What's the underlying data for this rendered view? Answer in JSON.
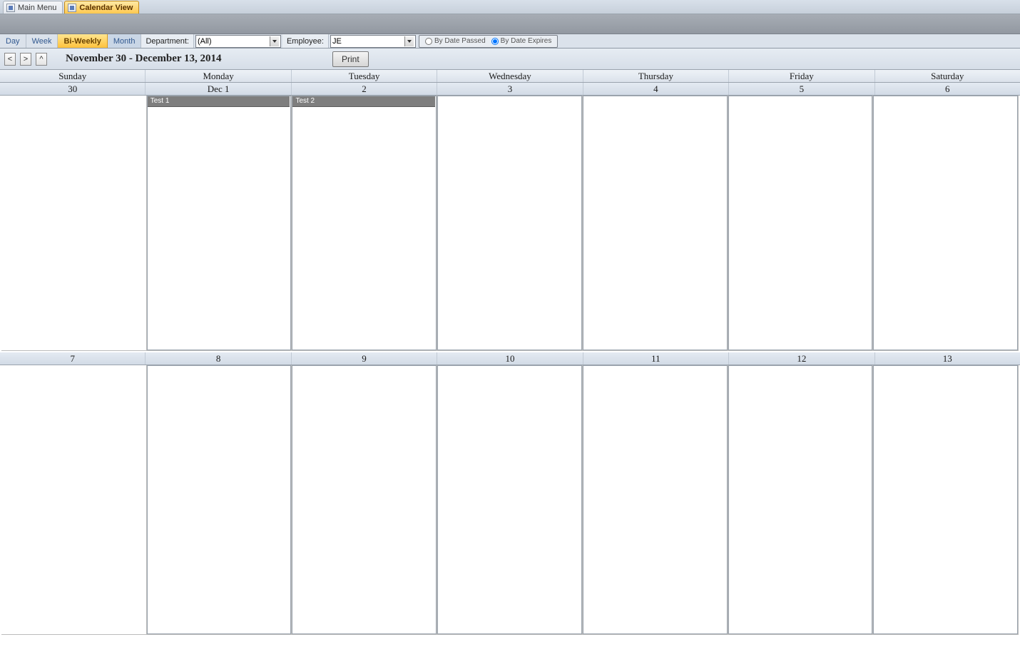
{
  "tabs": {
    "main_menu": "Main Menu",
    "calendar_view": "Calendar View"
  },
  "views": {
    "day": "Day",
    "week": "Week",
    "biweekly": "Bi-Weekly",
    "month": "Month"
  },
  "filters": {
    "department_label": "Department:",
    "department_value": "(All)",
    "employee_label": "Employee:",
    "employee_value": "JE"
  },
  "radios": {
    "by_date_passed": "By Date Passed",
    "by_date_expires": "By Date Expires"
  },
  "nav": {
    "prev": "<",
    "next": ">",
    "up": "^"
  },
  "title": "November 30 - December 13, 2014",
  "print": "Print",
  "day_headers": [
    "Sunday",
    "Monday",
    "Tuesday",
    "Wednesday",
    "Thursday",
    "Friday",
    "Saturday"
  ],
  "week1_dates": [
    "30",
    "Dec 1",
    "2",
    "3",
    "4",
    "5",
    "6"
  ],
  "week2_dates": [
    "7",
    "8",
    "9",
    "10",
    "11",
    "12",
    "13"
  ],
  "events": {
    "mon": "Test 1",
    "tue": "Test 2"
  }
}
